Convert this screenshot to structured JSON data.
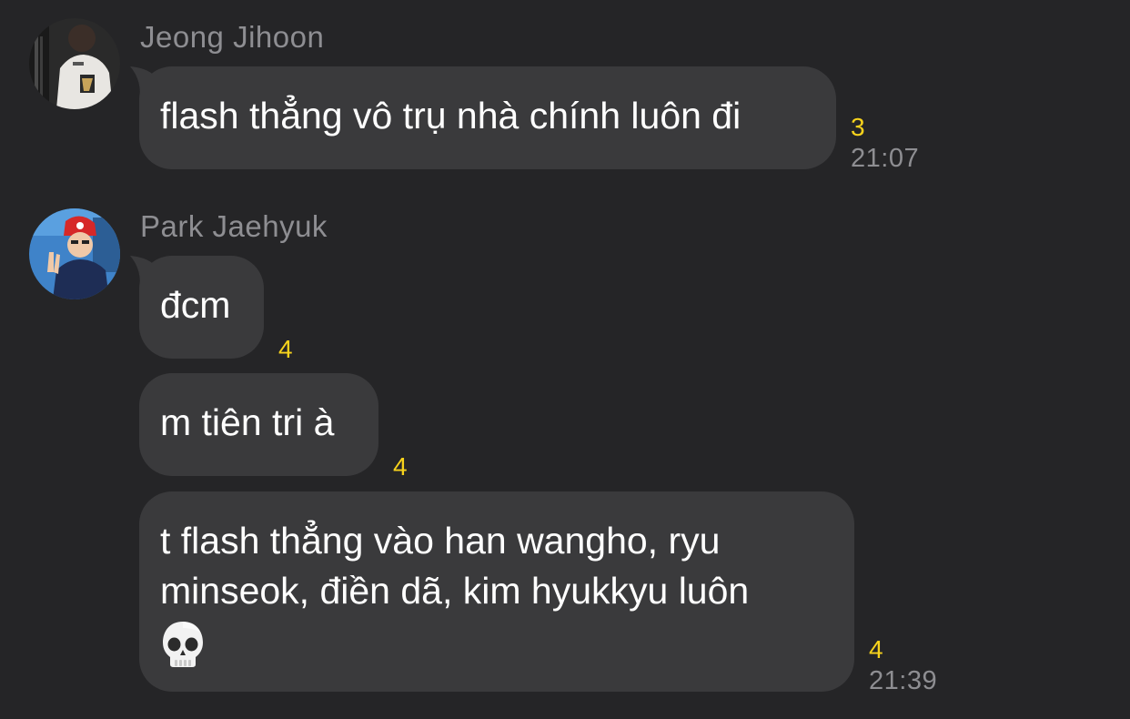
{
  "messages": [
    {
      "sender": "Jeong Jihoon",
      "avatar": "avatar-jeong-jihoon",
      "bubbles": [
        {
          "text": "flash thẳng vô trụ nhà chính luôn đi",
          "count": "3",
          "time": "21:07"
        }
      ]
    },
    {
      "sender": "Park Jaehyuk",
      "avatar": "avatar-park-jaehyuk",
      "bubbles": [
        {
          "text": "đcm",
          "count": "4"
        },
        {
          "text": "m tiên tri à",
          "count": "4"
        },
        {
          "line1": "t flash thẳng vào han wangho, ryu",
          "line2": "minseok, điền dã, kim hyukkyu luôn",
          "emoji": "skull-emoji",
          "count": "4",
          "time": "21:39"
        }
      ]
    }
  ],
  "colors": {
    "background": "#252527",
    "bubble": "#3a3a3c",
    "text": "#ffffff",
    "muted": "#8e8e92",
    "unread_count": "#f7d21c"
  }
}
